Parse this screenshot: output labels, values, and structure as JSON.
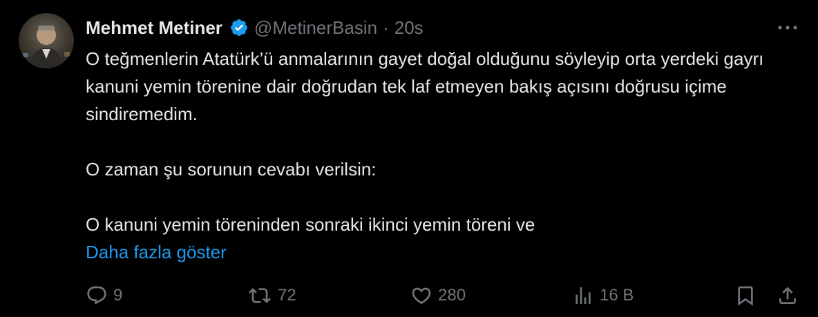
{
  "tweet": {
    "author_name": "Mehmet Metiner",
    "handle": "@MetinerBasin",
    "separator": "·",
    "time": "20s",
    "paragraphs": [
      "O teğmenlerin Atatürk’ü anmalarının gayet doğal olduğunu söyleyip orta yerdeki gayrı kanuni yemin törenine dair doğrudan tek laf etmeyen bakış açısını doğrusu içime sindiremedim.",
      "O zaman şu sorunun cevabı verilsin:",
      "O kanuni yemin töreninden sonraki ikinci yemin töreni ve"
    ],
    "show_more": "Daha fazla göster"
  },
  "actions": {
    "replies": "9",
    "reposts": "72",
    "likes": "280",
    "views": "16 B"
  },
  "icons": {
    "verified": "verified-badge-icon",
    "more": "more-horizontal-icon",
    "reply": "reply-icon",
    "repost": "repost-icon",
    "like": "heart-icon",
    "views": "bar-chart-icon",
    "bookmark": "bookmark-icon",
    "share": "share-icon"
  },
  "colors": {
    "background": "#000000",
    "text": "#e7e9ea",
    "secondary": "#71767b",
    "accent": "#1d9bf0"
  }
}
